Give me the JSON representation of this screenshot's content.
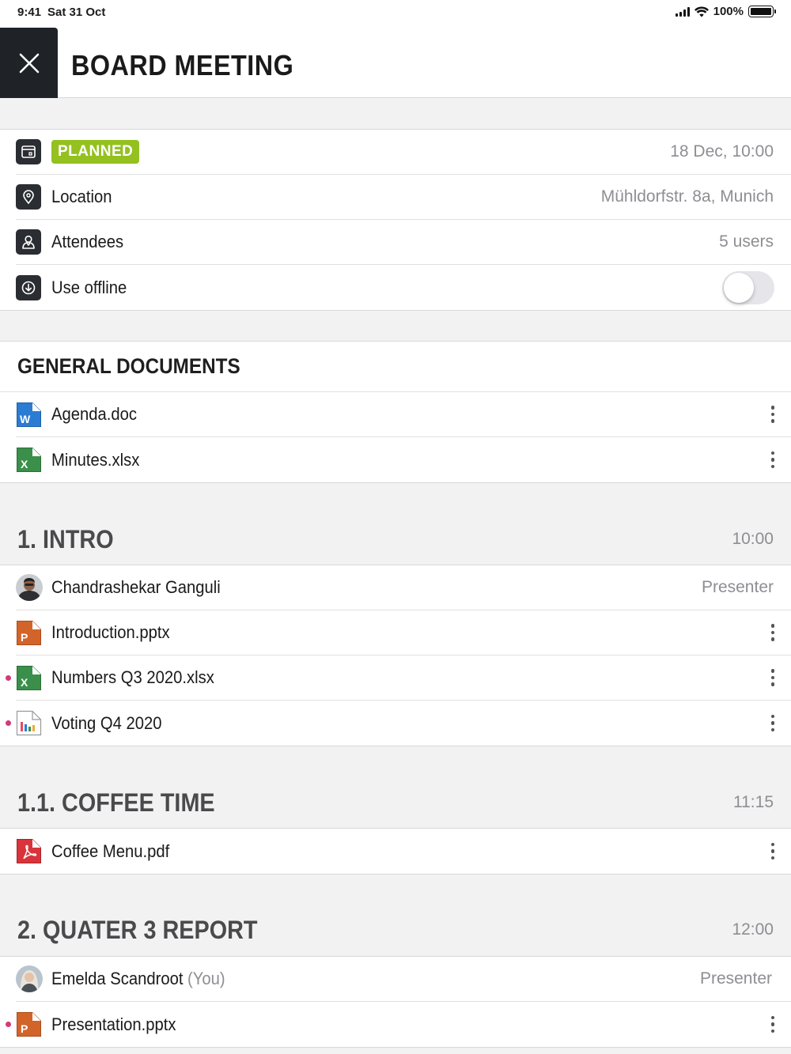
{
  "status_bar": {
    "time": "9:41",
    "date": "Sat 31 Oct",
    "battery": "100%"
  },
  "header": {
    "title": "BOARD MEETING",
    "close_icon": "close-icon"
  },
  "meta": {
    "status_badge": "PLANNED",
    "datetime": "18 Dec, 10:00",
    "location_label": "Location",
    "location_value": "Mühldorfstr. 8a, Munich",
    "attendees_label": "Attendees",
    "attendees_value": "5 users",
    "offline_label": "Use offline",
    "offline_enabled": false
  },
  "general_documents": {
    "title": "GENERAL DOCUMENTS",
    "items": [
      {
        "name": "Agenda.doc",
        "type": "word"
      },
      {
        "name": "Minutes.xlsx",
        "type": "excel"
      }
    ]
  },
  "agenda": [
    {
      "title": "1. INTRO",
      "time": "10:00",
      "presenter": {
        "name": "Chandrashekar Ganguli",
        "role": "Presenter"
      },
      "items": [
        {
          "name": "Introduction.pptx",
          "type": "powerpoint",
          "unread": false
        },
        {
          "name": "Numbers Q3 2020.xlsx",
          "type": "excel",
          "unread": true
        },
        {
          "name": "Voting Q4 2020",
          "type": "voting",
          "unread": true
        }
      ]
    },
    {
      "title": "1.1. COFFEE TIME",
      "time": "11:15",
      "items": [
        {
          "name": "Coffee Menu.pdf",
          "type": "pdf",
          "unread": false
        }
      ]
    },
    {
      "title": "2. QUATER 3 REPORT",
      "time": "12:00",
      "presenter": {
        "name": "Emelda Scandroot",
        "suffix": "(You)",
        "role": "Presenter"
      },
      "items": [
        {
          "name": "Presentation.pptx",
          "type": "powerpoint",
          "unread": true
        }
      ]
    }
  ],
  "colors": {
    "planned": "#94c11f",
    "word": "#2b7cd3",
    "excel": "#3a8f4a",
    "powerpoint": "#d2642a",
    "pdf": "#d9343b",
    "unread_dot": "#d33a78"
  }
}
